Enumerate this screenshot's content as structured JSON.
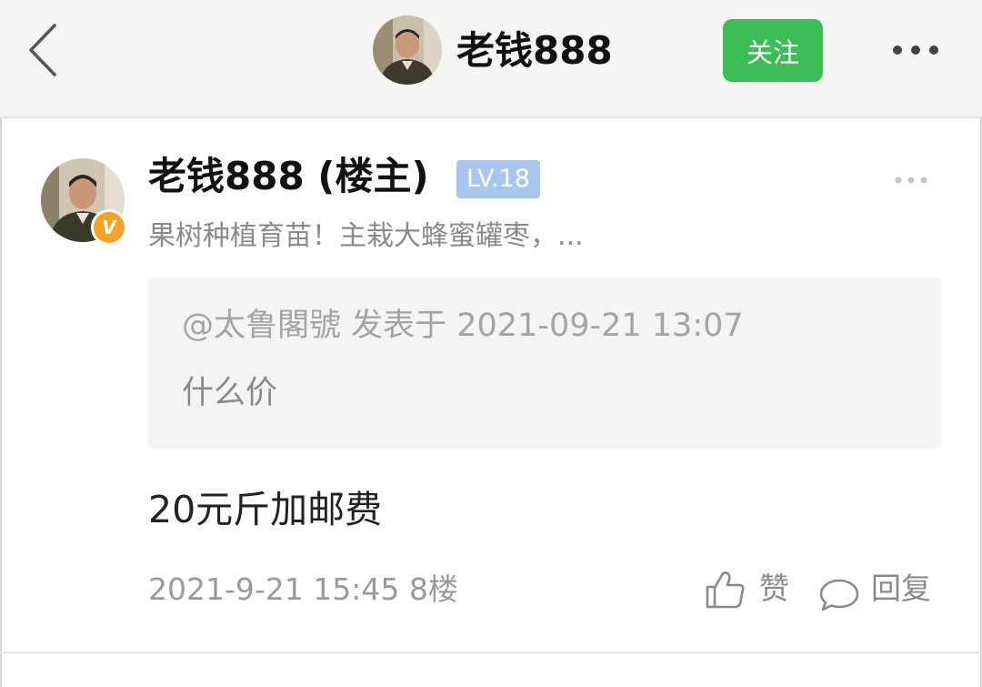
{
  "header": {
    "back_icon": "chevron-left-icon",
    "username": "老钱888",
    "follow_label": "关注",
    "more_icon": "more-horizontal-icon",
    "follow_color": "#3cbd56"
  },
  "post": {
    "author": "老钱888 (楼主)",
    "level": "LV.18",
    "level_color": "#a9c6ee",
    "vip_badge": "V",
    "bio": "果树种植育苗！主栽大蜂蜜罐枣，...",
    "quote": {
      "meta": "@太鲁閣號 发表于 2021-09-21 13:07",
      "text": "什么价"
    },
    "content": "20元斤加邮费",
    "time_floor": "2021-9-21 15:45  8楼",
    "like_label": "赞",
    "reply_label": "回复"
  }
}
